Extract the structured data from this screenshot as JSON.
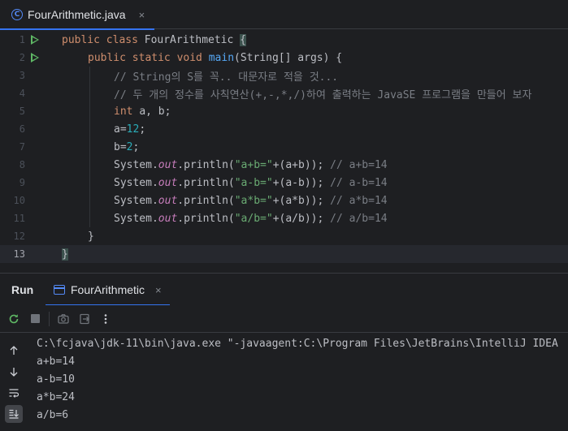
{
  "tab": {
    "icon": "java-class-icon",
    "label": "FourArithmetic.java",
    "close": "×"
  },
  "code_lines": [
    {
      "num": "1",
      "run": true,
      "indent": 0,
      "tokens": [
        {
          "t": "kw",
          "v": "public class "
        },
        {
          "t": "txt",
          "v": "FourArithmetic "
        },
        {
          "t": "brace",
          "v": "{"
        }
      ]
    },
    {
      "num": "2",
      "run": true,
      "indent": 1,
      "tokens": [
        {
          "t": "kw",
          "v": "public static void "
        },
        {
          "t": "fn",
          "v": "main"
        },
        {
          "t": "txt",
          "v": "(String[] args) {"
        }
      ]
    },
    {
      "num": "3",
      "run": false,
      "indent": 2,
      "tokens": [
        {
          "t": "cm",
          "v": "// String의 S를 꼭.. 대문자로 적을 것..."
        }
      ]
    },
    {
      "num": "4",
      "run": false,
      "indent": 2,
      "tokens": [
        {
          "t": "cm",
          "v": "// 두 개의 정수를 사칙연산(+,-,*,/)하여 출력하는 JavaSE 프로그램을 만들어 보자"
        }
      ]
    },
    {
      "num": "5",
      "run": false,
      "indent": 2,
      "tokens": [
        {
          "t": "kw",
          "v": "int "
        },
        {
          "t": "txt",
          "v": "a, b;"
        }
      ]
    },
    {
      "num": "6",
      "run": false,
      "indent": 2,
      "tokens": [
        {
          "t": "txt",
          "v": "a="
        },
        {
          "t": "num",
          "v": "12"
        },
        {
          "t": "txt",
          "v": ";"
        }
      ]
    },
    {
      "num": "7",
      "run": false,
      "indent": 2,
      "tokens": [
        {
          "t": "txt",
          "v": "b="
        },
        {
          "t": "num",
          "v": "2"
        },
        {
          "t": "txt",
          "v": ";"
        }
      ]
    },
    {
      "num": "8",
      "run": false,
      "indent": 2,
      "tokens": [
        {
          "t": "txt",
          "v": "System."
        },
        {
          "t": "st",
          "v": "out"
        },
        {
          "t": "txt",
          "v": ".println("
        },
        {
          "t": "str",
          "v": "\"a+b=\""
        },
        {
          "t": "txt",
          "v": "+(a+b)); "
        },
        {
          "t": "cm",
          "v": "// a+b=14"
        }
      ]
    },
    {
      "num": "9",
      "run": false,
      "indent": 2,
      "tokens": [
        {
          "t": "txt",
          "v": "System."
        },
        {
          "t": "st",
          "v": "out"
        },
        {
          "t": "txt",
          "v": ".println("
        },
        {
          "t": "str",
          "v": "\"a-b=\""
        },
        {
          "t": "txt",
          "v": "+(a-b)); "
        },
        {
          "t": "cm",
          "v": "// a-b=14"
        }
      ]
    },
    {
      "num": "10",
      "run": false,
      "indent": 2,
      "tokens": [
        {
          "t": "txt",
          "v": "System."
        },
        {
          "t": "st",
          "v": "out"
        },
        {
          "t": "txt",
          "v": ".println("
        },
        {
          "t": "str",
          "v": "\"a*b=\""
        },
        {
          "t": "txt",
          "v": "+(a*b)); "
        },
        {
          "t": "cm",
          "v": "// a*b=14"
        }
      ]
    },
    {
      "num": "11",
      "run": false,
      "indent": 2,
      "tokens": [
        {
          "t": "txt",
          "v": "System."
        },
        {
          "t": "st",
          "v": "out"
        },
        {
          "t": "txt",
          "v": ".println("
        },
        {
          "t": "str",
          "v": "\"a/b=\""
        },
        {
          "t": "txt",
          "v": "+(a/b)); "
        },
        {
          "t": "cm",
          "v": "// a/b=14"
        }
      ]
    },
    {
      "num": "12",
      "run": false,
      "indent": 1,
      "tokens": [
        {
          "t": "txt",
          "v": "}"
        }
      ]
    },
    {
      "num": "13",
      "run": false,
      "indent": 0,
      "current": true,
      "tokens": [
        {
          "t": "brace",
          "v": "}"
        }
      ]
    }
  ],
  "run_panel": {
    "title": "Run",
    "tab_label": "FourArithmetic",
    "tab_close": "×",
    "toolbar": [
      "rerun-icon",
      "stop-icon",
      "camera-icon",
      "exit-icon",
      "more-icon"
    ],
    "side_tools": [
      "arrow-up-icon",
      "arrow-down-icon",
      "soft-wrap-icon",
      "scroll-to-end-icon"
    ],
    "console_lines": [
      "C:\\fcjava\\jdk-11\\bin\\java.exe \"-javaagent:C:\\Program Files\\JetBrains\\IntelliJ IDEA",
      "a+b=14",
      "a-b=10",
      "a*b=24",
      "a/b=6"
    ]
  },
  "colors": {
    "background": "#1e1f22",
    "keyword": "#cf8e6d",
    "function": "#56a8f5",
    "comment": "#7a7e85",
    "string": "#6aab73",
    "number": "#2aacb8",
    "static_field": "#c77dbb",
    "accent": "#3574f0",
    "run_green": "#5fb865"
  }
}
